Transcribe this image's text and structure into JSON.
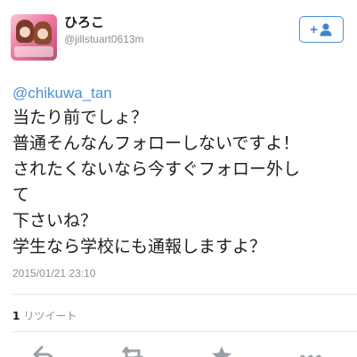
{
  "user": {
    "display_name": "ひろこ",
    "handle": "@jillstuart0613m"
  },
  "follow_button": {
    "plus": "+"
  },
  "tweet": {
    "mention": "@chikuwa_tan",
    "lines": [
      "当たり前でしょ？",
      "普通そんなんフォローしないですよ！",
      "されたくないなら今すぐフォロー外し",
      "て",
      "下さいね？",
      "学生なら学校にも通報しますよ？"
    ],
    "timestamp": "2015/01/21 23:10"
  },
  "stats": {
    "retweet_count": "1",
    "retweet_label": "リツイート"
  },
  "icons": {
    "follow": "add-user-icon",
    "reply": "reply-icon",
    "retweet": "retweet-icon",
    "favorite": "star-icon",
    "more": "more-icon"
  },
  "colors": {
    "accent": "#4a90d9",
    "text": "#1d1d1d",
    "muted": "#8b8f94",
    "divider": "#e1e6ea"
  }
}
